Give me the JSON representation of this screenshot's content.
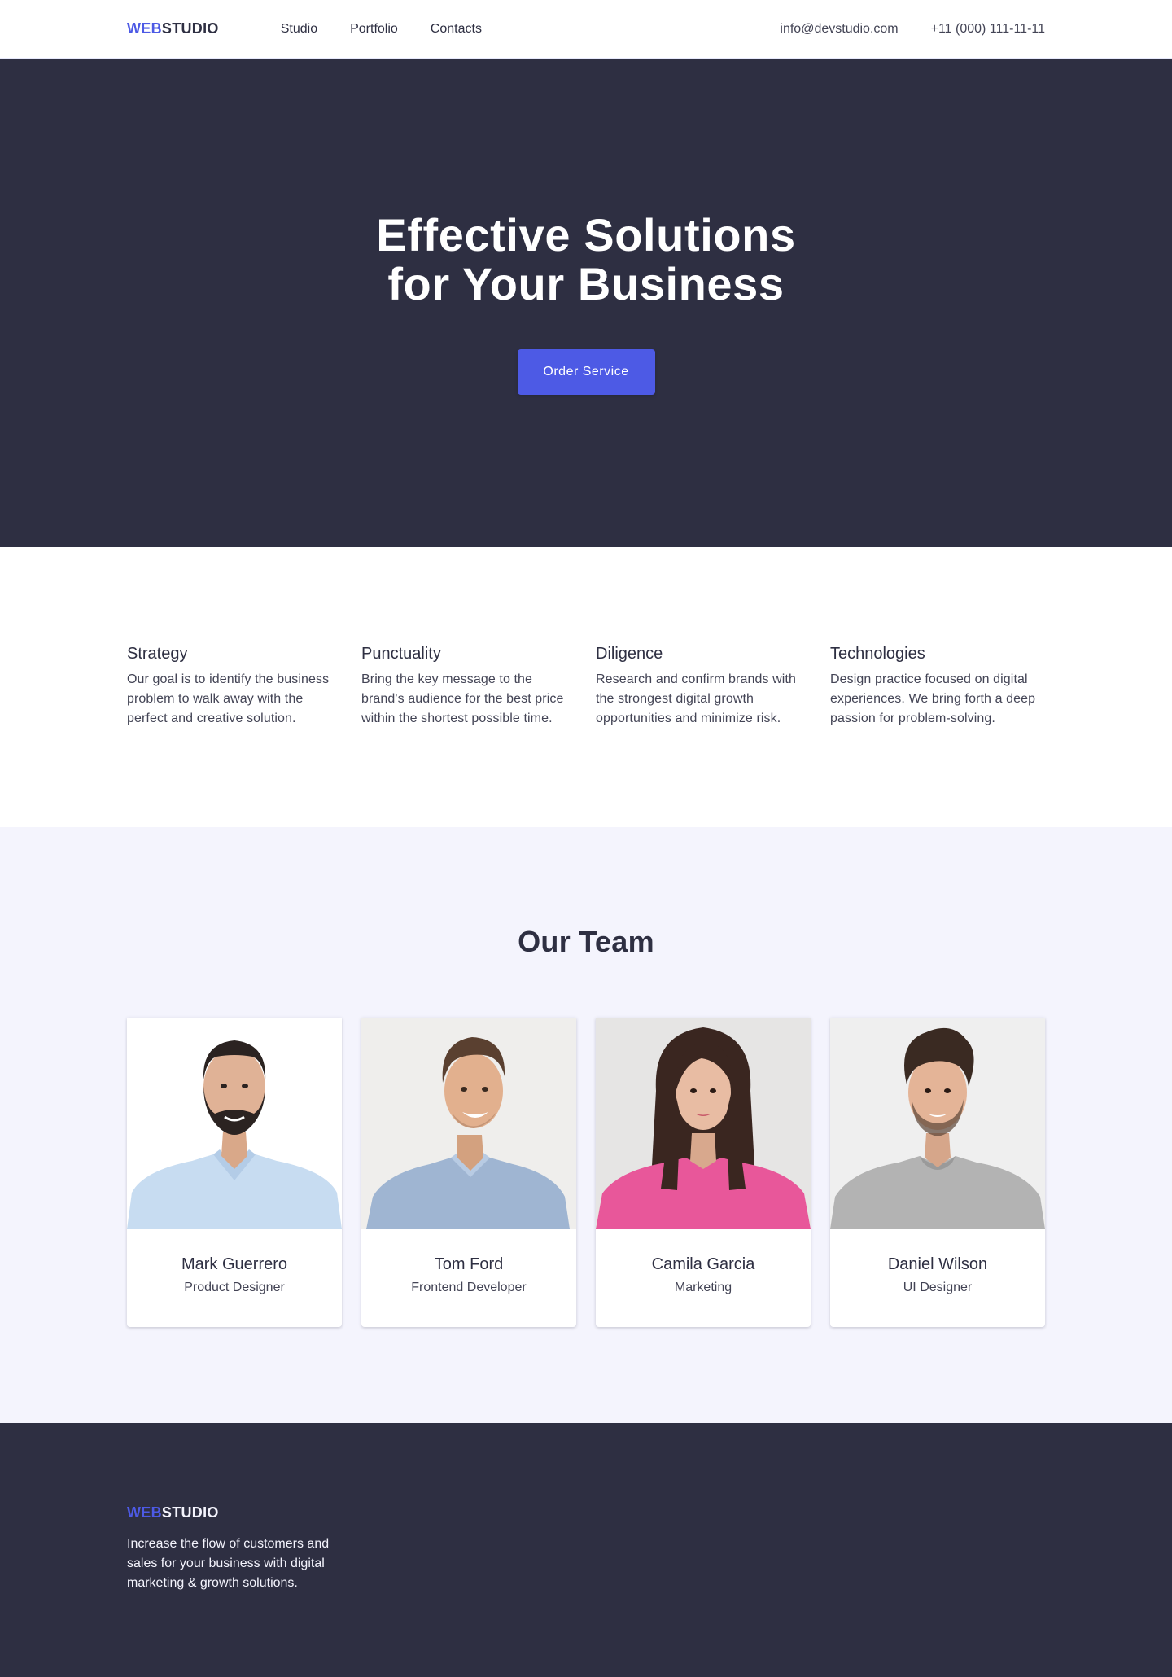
{
  "header": {
    "logo": {
      "accent": "WEB",
      "rest": "STUDIO"
    },
    "nav": [
      {
        "label": "Studio"
      },
      {
        "label": "Portfolio"
      },
      {
        "label": "Contacts"
      }
    ],
    "email": "info@devstudio.com",
    "phone": "+11 (000) 111-11-11"
  },
  "hero": {
    "title_line1": "Effective Solutions",
    "title_line2": "for Your Business",
    "button_label": "Order Service"
  },
  "features": [
    {
      "title": "Strategy",
      "text": "Our goal is to identify the business problem to walk away with the perfect and creative solution."
    },
    {
      "title": "Punctuality",
      "text": "Bring the key message to the brand's audience for the best price within the shortest possible time."
    },
    {
      "title": "Diligence",
      "text": "Research and confirm brands with the strongest digital growth opportunities and minimize risk."
    },
    {
      "title": "Technologies",
      "text": "Design practice focused on digital experiences. We bring forth a deep passion for problem-solving."
    }
  ],
  "team": {
    "title": "Our Team",
    "members": [
      {
        "name": "Mark Guerrero",
        "role": "Product Designer",
        "photo_icon": "man-beard-portrait-icon"
      },
      {
        "name": "Tom Ford",
        "role": "Frontend Developer",
        "photo_icon": "man-smiling-portrait-icon"
      },
      {
        "name": "Camila Garcia",
        "role": "Marketing",
        "photo_icon": "woman-portrait-icon"
      },
      {
        "name": "Daniel Wilson",
        "role": "UI Designer",
        "photo_icon": "man-curly-hair-portrait-icon"
      }
    ]
  },
  "footer": {
    "logo": {
      "accent": "WEB",
      "rest": "STUDIO"
    },
    "text": "Increase the flow of customers and sales for your business with digital marketing & growth solutions."
  },
  "colors": {
    "accent": "#4d5ae5",
    "dark": "#2e2f42",
    "text_secondary": "#434455",
    "light_bg": "#f4f4fd"
  }
}
